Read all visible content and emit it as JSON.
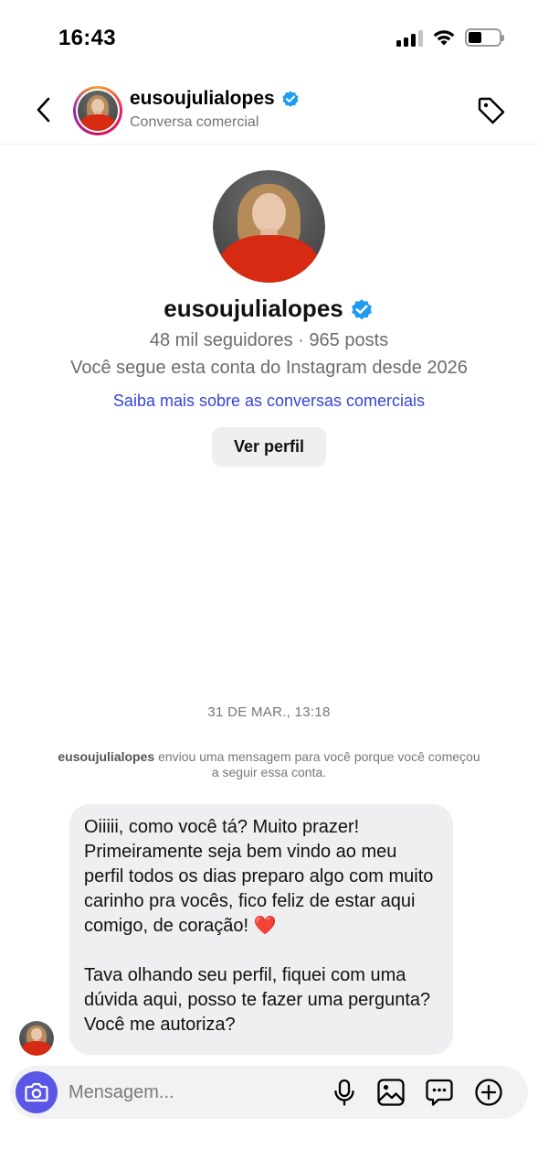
{
  "status_bar": {
    "time": "16:43"
  },
  "header": {
    "username": "eusoujulialopes",
    "subtitle": "Conversa comercial"
  },
  "profile": {
    "username": "eusoujulialopes",
    "stats": "48 mil seguidores · 965 posts",
    "following_since": "Você segue esta conta do Instagram desde 2026",
    "learn_more_link": "Saiba mais sobre as conversas comerciais",
    "view_profile_button": "Ver perfil"
  },
  "chat": {
    "timestamp": "31 DE MAR., 13:18",
    "system_note": {
      "username": "eusoujulialopes",
      "text": " enviou uma mensagem para você porque você começou a seguir essa conta."
    },
    "message": {
      "paragraph1": "Oiiiii, como você tá? Muito prazer! Primeiramente seja bem vindo ao meu perfil todos os dias preparo algo com muito carinho pra vocês, fico feliz de estar aqui comigo, de coração!",
      "heart": "❤️",
      "paragraph2": "Tava olhando seu perfil, fiquei com uma dúvida aqui, posso te fazer uma pergunta? Você me autoriza?"
    }
  },
  "composer": {
    "placeholder": "Mensagem..."
  },
  "colors": {
    "verified_blue": "#1d9bf0",
    "link_blue": "#3545d9",
    "camera_button": "#5a57e6",
    "bubble_bg": "#efeff1"
  },
  "icons": [
    "back-chevron-icon",
    "verified-badge-icon",
    "tag-icon",
    "camera-icon",
    "microphone-icon",
    "gallery-icon",
    "sticker-chat-icon",
    "plus-circle-icon"
  ]
}
